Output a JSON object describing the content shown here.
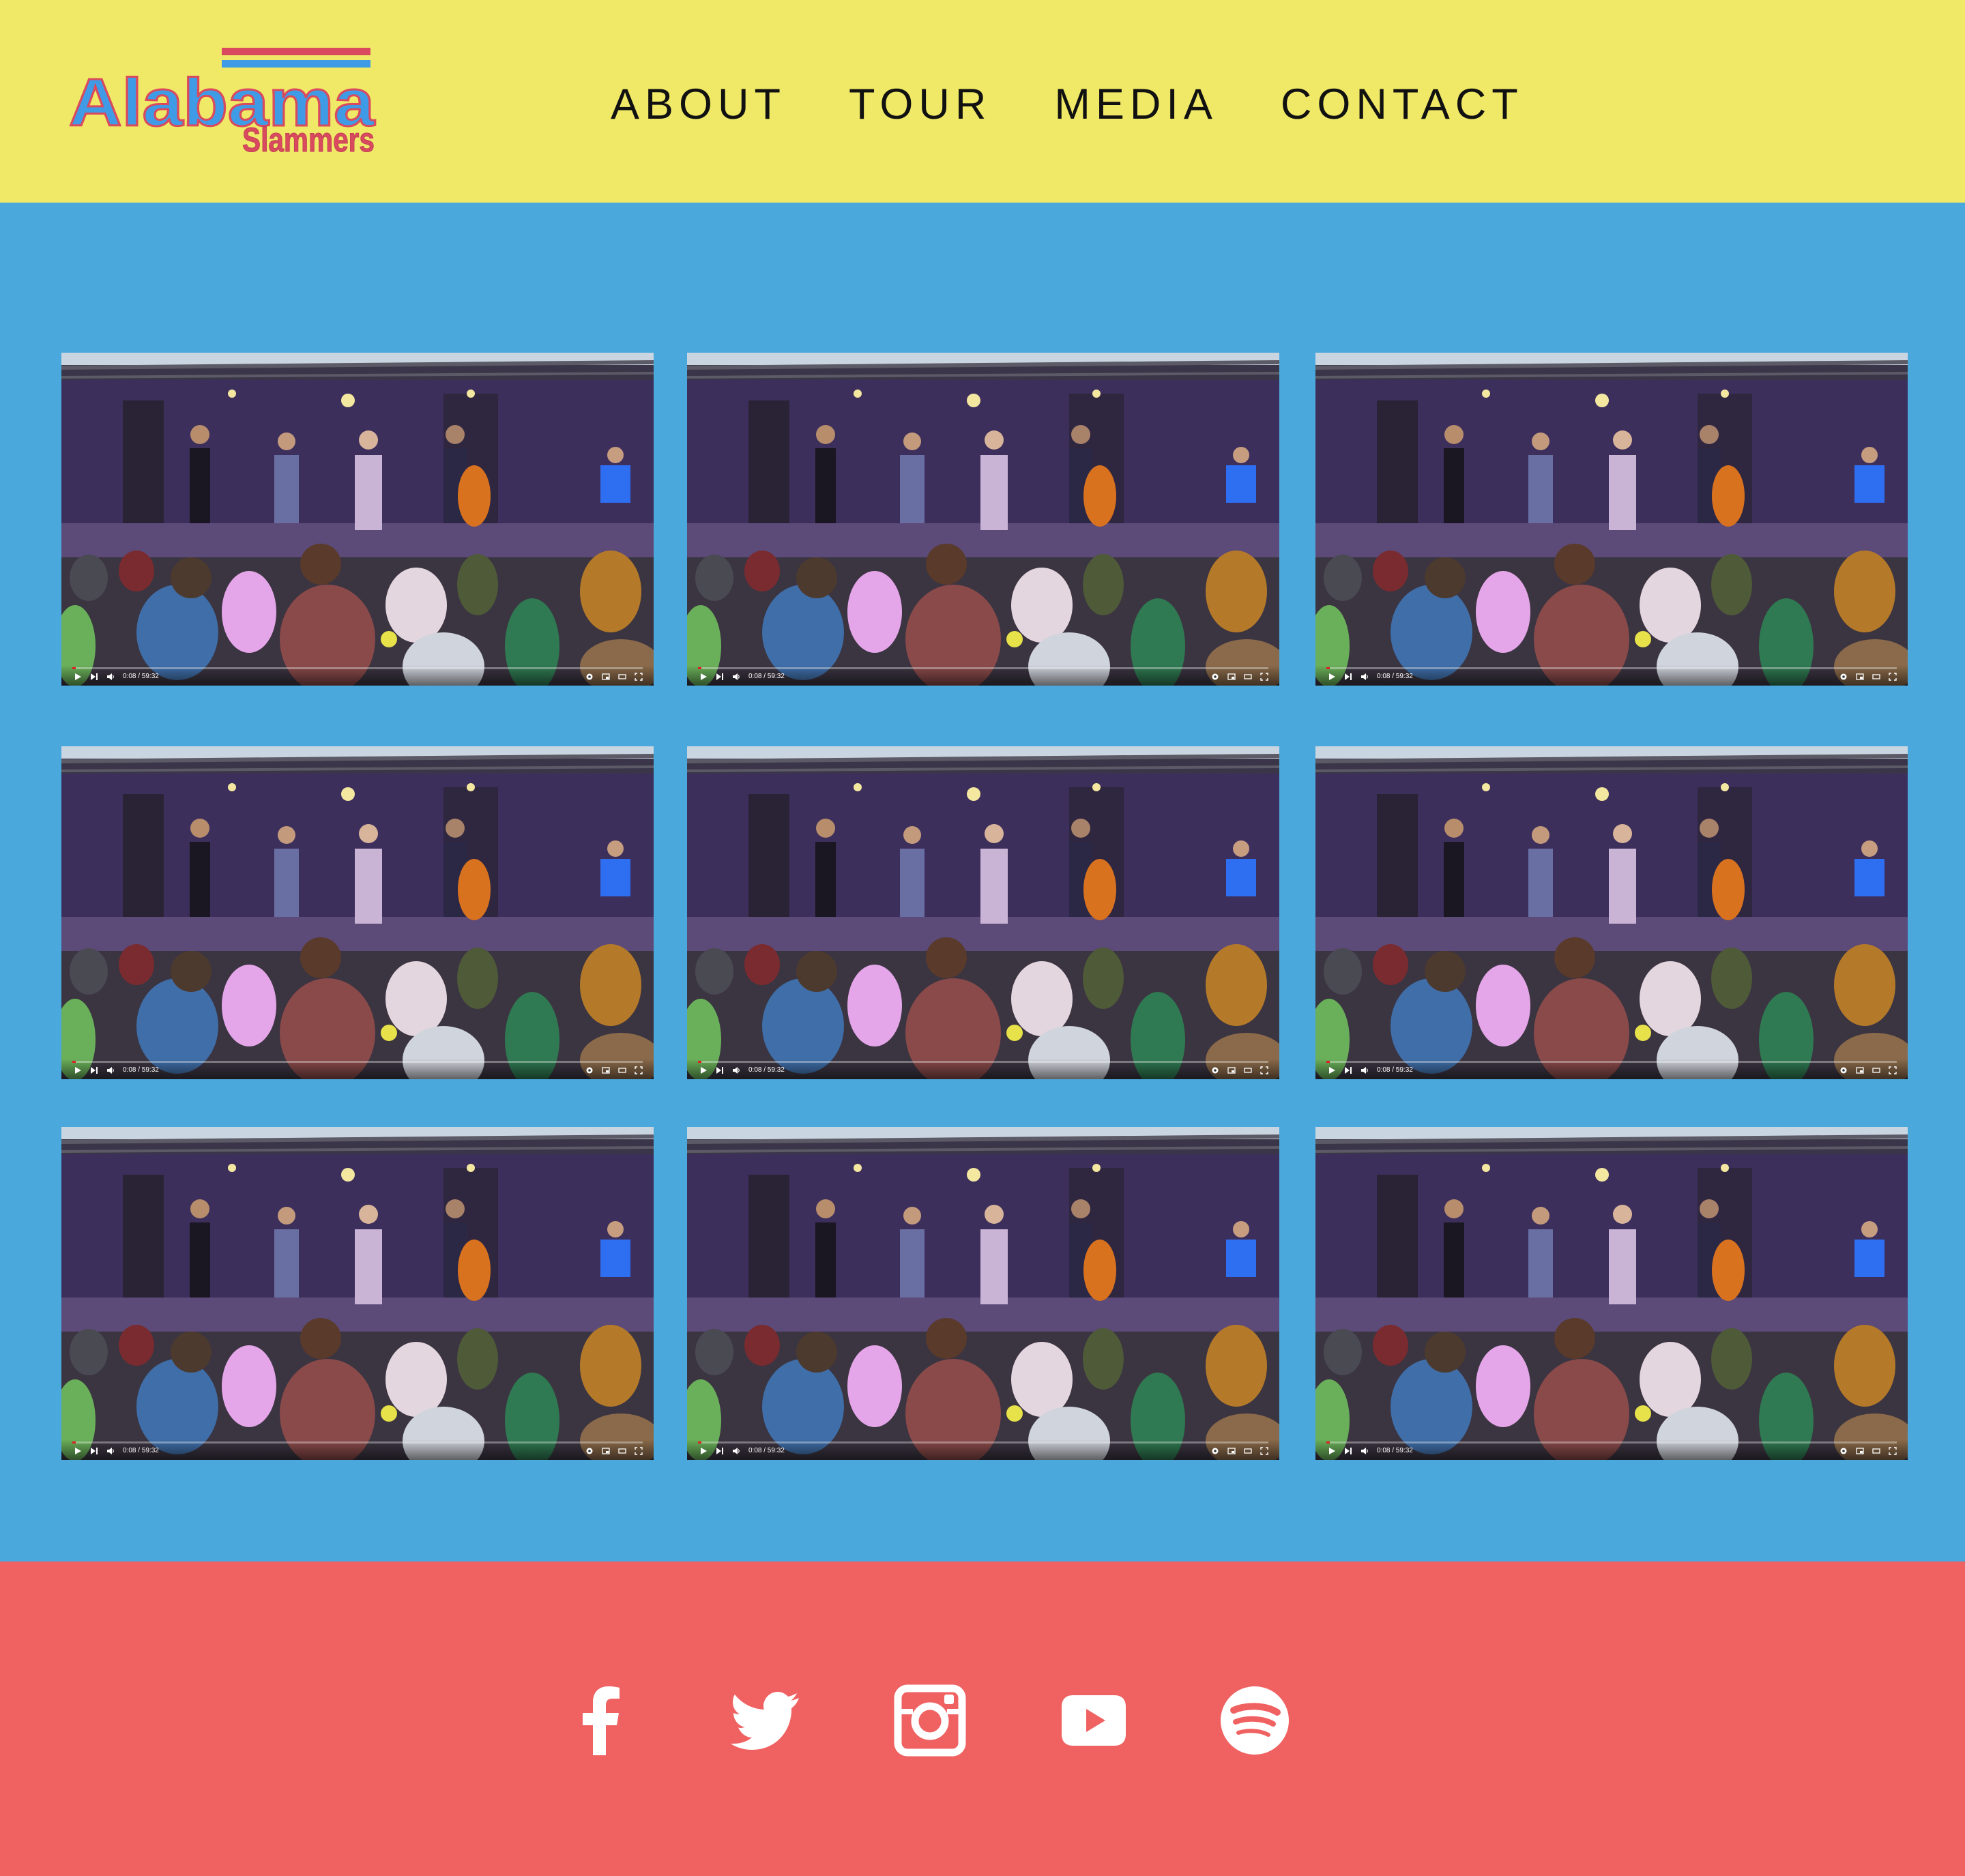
{
  "brand": {
    "name": "Alabama Slammers",
    "logo_line1": "Alabama",
    "logo_line2": "Slammers",
    "colors": {
      "header_bg": "#f0e967",
      "main_bg": "#4aa8dc",
      "footer_bg": "#f06262",
      "logo_blue": "#3f9be6",
      "logo_red": "#d94a5e"
    }
  },
  "nav": {
    "items": [
      "ABOUT",
      "TOUR",
      "MEDIA",
      "CONTACT"
    ]
  },
  "videos": {
    "items": [
      {
        "time": "0:08 / 59:32",
        "progress": 0.002
      },
      {
        "time": "0:08 / 59:32",
        "progress": 0.002
      },
      {
        "time": "0:08 / 59:32",
        "progress": 0.002
      },
      {
        "time": "0:08 / 59:32",
        "progress": 0.002
      },
      {
        "time": "0:08 / 59:32",
        "progress": 0.002
      },
      {
        "time": "0:08 / 59:32",
        "progress": 0.002
      },
      {
        "time": "0:08 / 59:32",
        "progress": 0.002
      },
      {
        "time": "0:08 / 59:32",
        "progress": 0.002
      },
      {
        "time": "0:08 / 59:32",
        "progress": 0.002
      }
    ],
    "player_icons": [
      "play-icon",
      "next-icon",
      "volume-icon",
      "settings-icon",
      "miniplayer-icon",
      "theater-icon",
      "fullscreen-icon"
    ]
  },
  "social": {
    "items": [
      "facebook-icon",
      "twitter-icon",
      "instagram-icon",
      "youtube-icon",
      "spotify-icon"
    ]
  }
}
